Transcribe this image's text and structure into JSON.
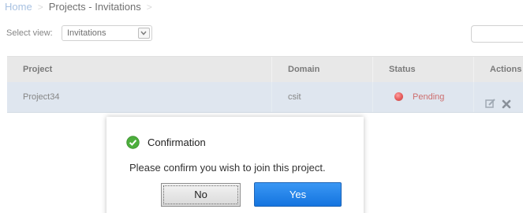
{
  "breadcrumb": {
    "home": "Home",
    "current": "Projects - Invitations"
  },
  "view_select": {
    "label": "Select view:",
    "value": "Invitations"
  },
  "table": {
    "headers": {
      "project": "Project",
      "domain": "Domain",
      "status": "Status",
      "actions": "Actions"
    },
    "rows": [
      {
        "project": "Project34",
        "domain": "csit",
        "status": "Pending"
      }
    ]
  },
  "dialog": {
    "title": "Confirmation",
    "message": "Please confirm you wish to join this project.",
    "no_label": "No",
    "yes_label": "Yes"
  },
  "colors": {
    "status_pending": "#b21e1e",
    "yes_button": "#1e7be6",
    "row_highlight": "#ced9e6",
    "header_bg": "#dcdcdc"
  },
  "icons": [
    "chevron-down-icon",
    "status-dot-icon",
    "edit-icon",
    "delete-icon",
    "check-circle-icon"
  ]
}
